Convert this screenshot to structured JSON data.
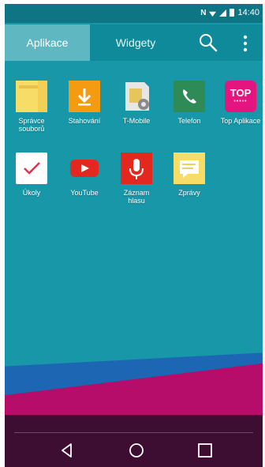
{
  "status_bar": {
    "time": "14:40",
    "icons": [
      "nfc-icon",
      "wifi-icon",
      "signal-icon",
      "battery-icon"
    ]
  },
  "tabs": [
    {
      "label": "Aplikace",
      "selected": true
    },
    {
      "label": "Widgety",
      "selected": false
    }
  ],
  "toolbar": {
    "icons": [
      "search-icon",
      "overflow-menu-icon"
    ]
  },
  "apps": [
    {
      "label": "Správce souborů",
      "icon": "file-manager-icon",
      "color": "#f7dc68"
    },
    {
      "label": "Stahování",
      "icon": "download-icon",
      "color": "#f39c12"
    },
    {
      "label": "T-Mobile",
      "icon": "sim-settings-icon",
      "color": "#d9d9d9"
    },
    {
      "label": "Telefon",
      "icon": "phone-icon",
      "color": "#2e8b57"
    },
    {
      "label": "Top Aplikace",
      "icon": "top-apps-icon",
      "color": "#e5157f"
    },
    {
      "label": "Úkoly",
      "icon": "checkmark-icon",
      "color": "#ffffff"
    },
    {
      "label": "YouTube",
      "icon": "youtube-icon",
      "color": "#e3291f"
    },
    {
      "label": "Záznam hlasu",
      "icon": "microphone-icon",
      "color": "#e3291f"
    },
    {
      "label": "Zprávy",
      "icon": "messages-icon",
      "color": "#f7dc68"
    }
  ],
  "top_apps_badge": "TOP",
  "nav": {
    "icons": [
      "back-icon",
      "home-icon",
      "recents-icon"
    ]
  }
}
